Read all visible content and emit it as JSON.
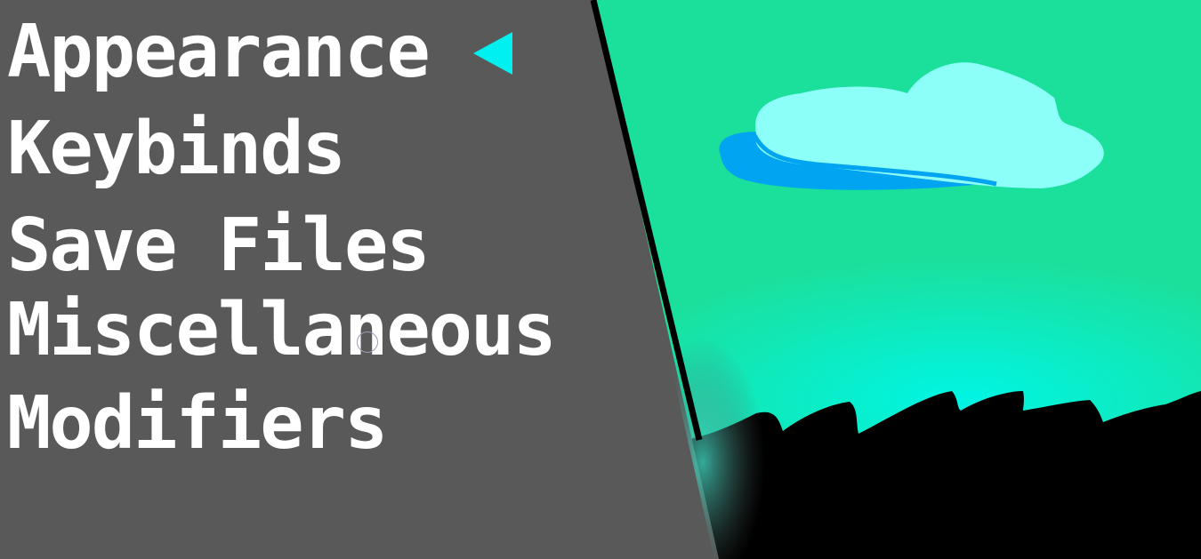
{
  "menu": {
    "items": [
      {
        "label": "Appearance",
        "selected": true
      },
      {
        "label": "Keybinds",
        "selected": false
      },
      {
        "label": "Save Files",
        "selected": false
      },
      {
        "label": "Miscellaneous",
        "selected": false
      },
      {
        "label": "Modifiers",
        "selected": false
      }
    ]
  },
  "colors": {
    "panel": "#595959",
    "sky": "#1be09c",
    "horizon_glow": "#00f5e4",
    "cloud": "#8cfff8",
    "cloud_shadow": "#00a4f0",
    "selector": "#00f0f0",
    "hills": "#000000"
  }
}
